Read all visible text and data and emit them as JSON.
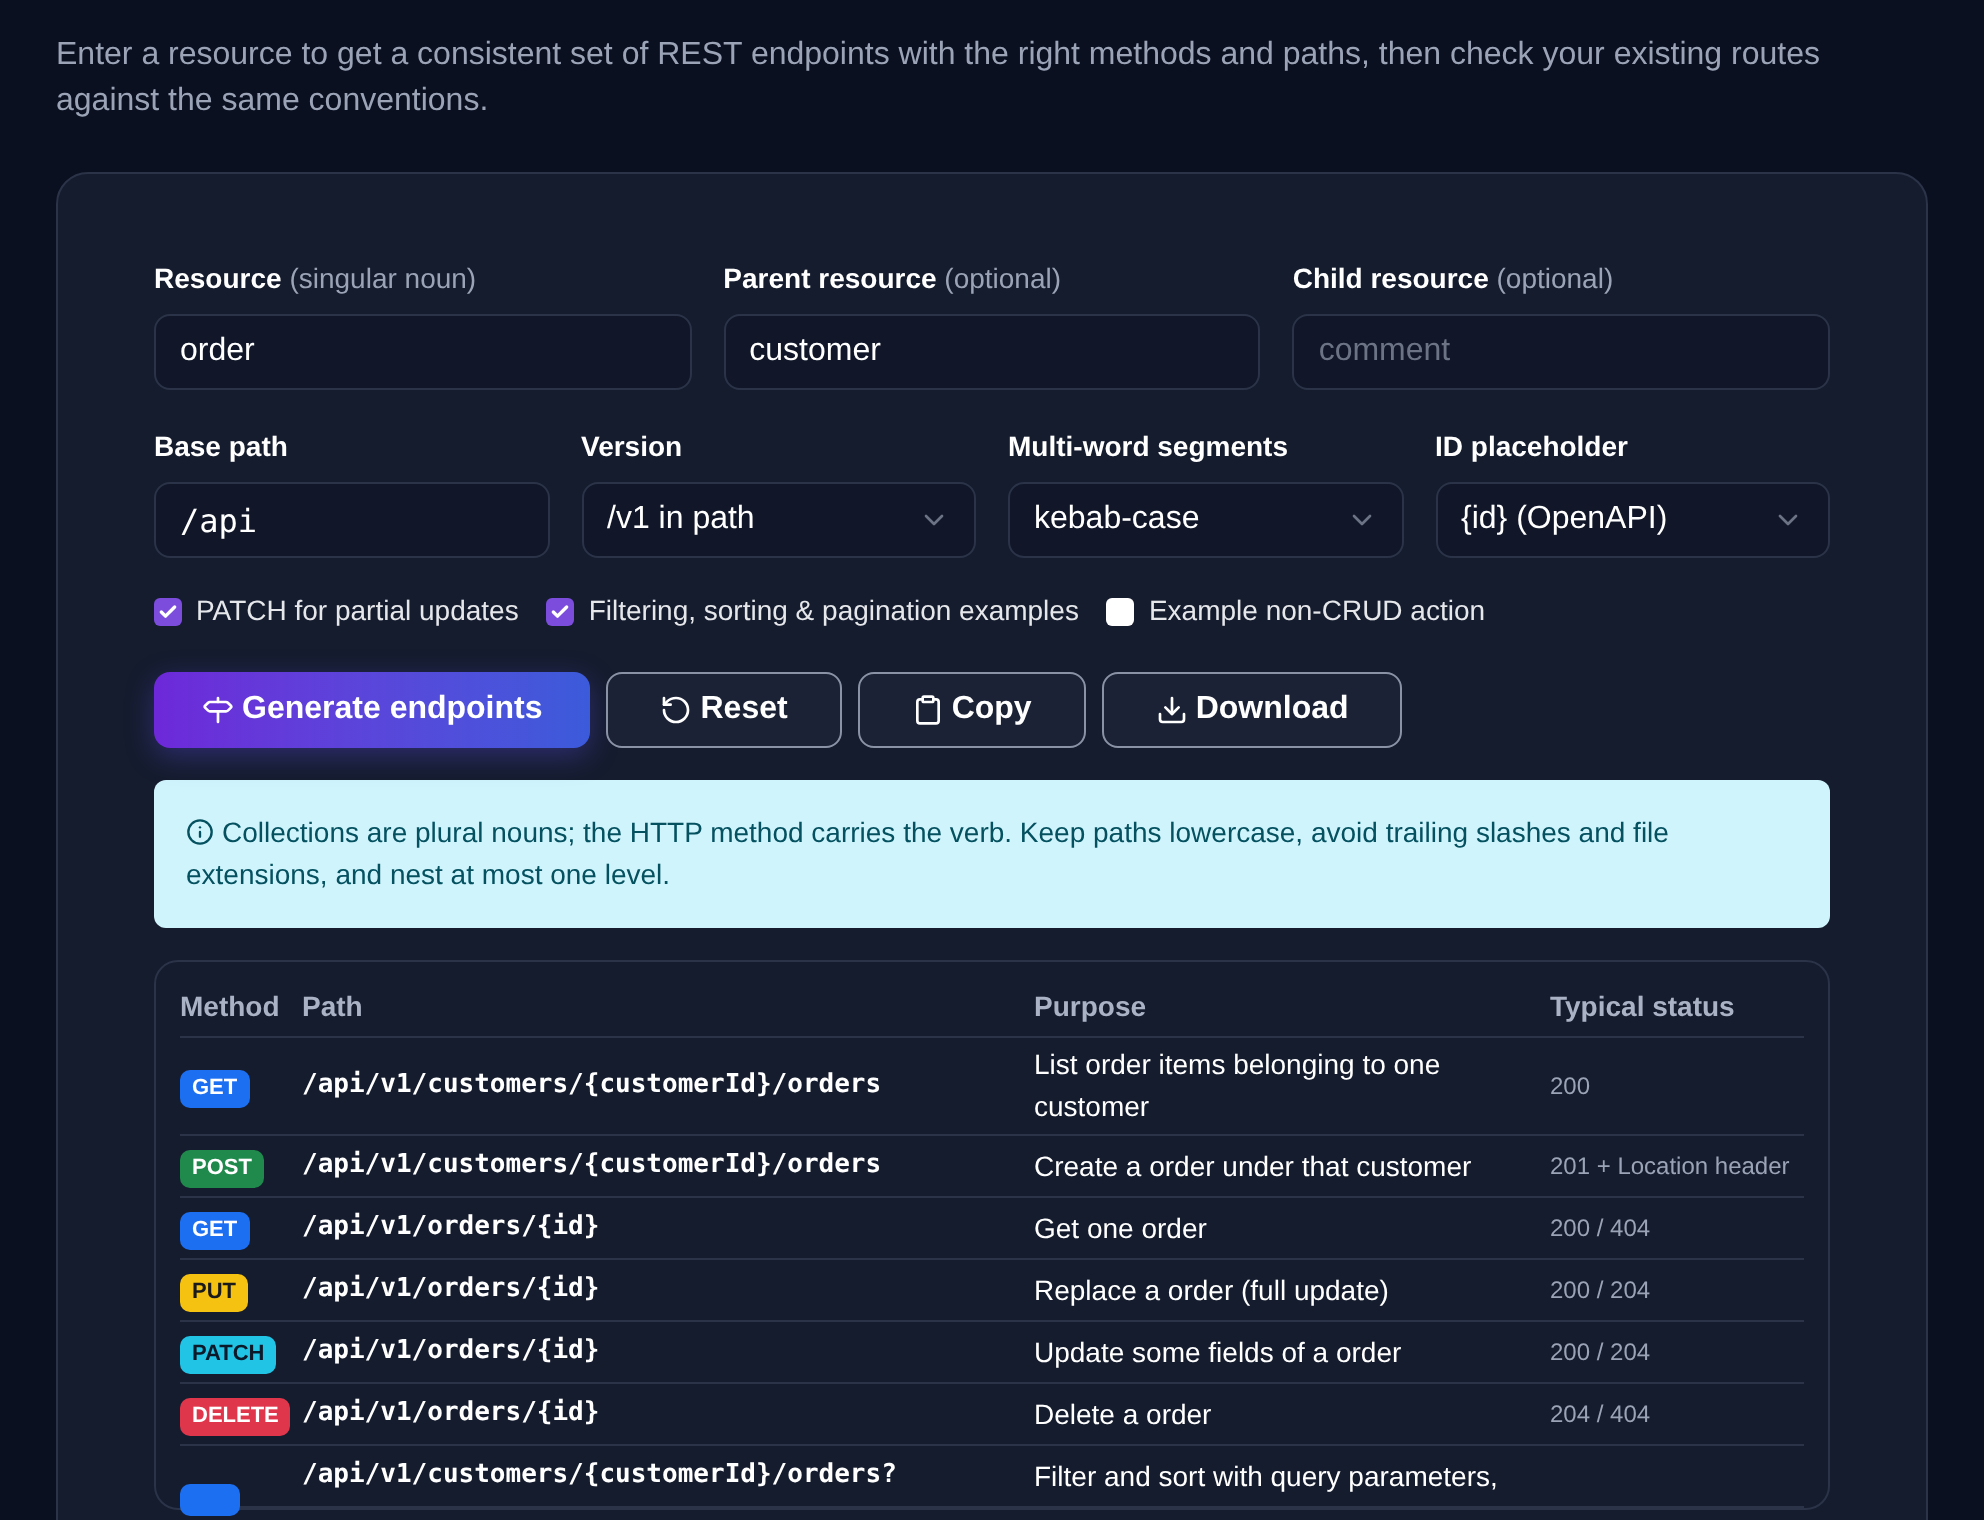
{
  "intro": "Enter a resource to get a consistent set of REST endpoints with the right methods and paths, then check your existing routes against the same conventions.",
  "fields_row1": [
    {
      "label": "Resource",
      "hint": "(singular noun)",
      "value": "order"
    },
    {
      "label": "Parent resource",
      "hint": "(optional)",
      "value": "customer"
    },
    {
      "label": "Child resource",
      "hint": "(optional)",
      "placeholder": "comment"
    }
  ],
  "fields_row2": [
    {
      "label": "Base path",
      "kind": "text",
      "value": "/api"
    },
    {
      "label": "Version",
      "kind": "select",
      "value": "/v1 in path"
    },
    {
      "label": "Multi-word segments",
      "kind": "select",
      "value": "kebab-case"
    },
    {
      "label": "ID placeholder",
      "kind": "select",
      "value": "{id} (OpenAPI)"
    }
  ],
  "options": [
    {
      "label": "PATCH for partial updates",
      "checked": true
    },
    {
      "label": "Filtering, sorting & pagination examples",
      "checked": true
    },
    {
      "label": "Example non-CRUD action",
      "checked": false
    }
  ],
  "buttons": [
    {
      "label": "Generate endpoints",
      "kind": "primary"
    },
    {
      "label": "Reset",
      "kind": "reset"
    },
    {
      "label": "Copy",
      "kind": "copy"
    },
    {
      "label": "Download",
      "kind": "download"
    }
  ],
  "notice": "Collections are plural nouns; the HTTP method carries the verb. Keep paths lowercase, avoid trailing slashes and file extensions, and nest at most one level.",
  "table": {
    "columns": [
      "Method",
      "Path",
      "Purpose",
      "Typical status"
    ],
    "rows": [
      {
        "method": "GET",
        "kind": "get",
        "path": "/api/v1/customers/{customerId}/orders",
        "purpose": "List order items belonging to one customer",
        "status": "200"
      },
      {
        "method": "POST",
        "kind": "post",
        "path": "/api/v1/customers/{customerId}/orders",
        "purpose": "Create a order under that customer",
        "status": "201 + Location header"
      },
      {
        "method": "GET",
        "kind": "get",
        "path": "/api/v1/orders/{id}",
        "purpose": "Get one order",
        "status": "200 / 404"
      },
      {
        "method": "PUT",
        "kind": "put",
        "path": "/api/v1/orders/{id}",
        "purpose": "Replace a order (full update)",
        "status": "200 / 204"
      },
      {
        "method": "PATCH",
        "kind": "patch",
        "path": "/api/v1/orders/{id}",
        "purpose": "Update some fields of a order",
        "status": "200 / 204"
      },
      {
        "method": "DELETE",
        "kind": "delete",
        "path": "/api/v1/orders/{id}",
        "purpose": "Delete a order",
        "status": "204 / 404"
      },
      {
        "kind": "get",
        "path": "/api/v1/customers/{customerId}/orders?",
        "purpose": "Filter and sort with query parameters,"
      }
    ]
  }
}
